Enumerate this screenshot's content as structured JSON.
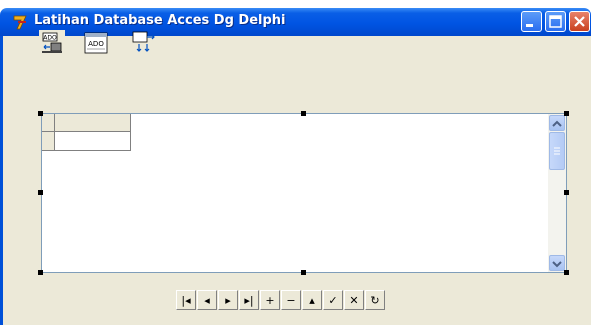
{
  "window": {
    "title": "Latihan Database Acces Dg Delphi"
  },
  "colors": {
    "titlebar": "#0054e3",
    "client": "#ece9d8",
    "close": "#c9401e"
  },
  "components": [
    {
      "name": "adoconnection-icon",
      "label": "ADO"
    },
    {
      "name": "adotable-icon",
      "label": "ADO"
    },
    {
      "name": "datasource-icon",
      "label": ""
    }
  ],
  "navigator": {
    "buttons": [
      {
        "name": "nav-first-button",
        "glyph": "|◂"
      },
      {
        "name": "nav-prior-button",
        "glyph": "◂"
      },
      {
        "name": "nav-next-button",
        "glyph": "▸"
      },
      {
        "name": "nav-last-button",
        "glyph": "▸|"
      },
      {
        "name": "nav-insert-button",
        "glyph": "+"
      },
      {
        "name": "nav-delete-button",
        "glyph": "−"
      },
      {
        "name": "nav-edit-button",
        "glyph": "▴"
      },
      {
        "name": "nav-post-button",
        "glyph": "✓"
      },
      {
        "name": "nav-cancel-button",
        "glyph": "✕"
      },
      {
        "name": "nav-refresh-button",
        "glyph": "↻"
      }
    ]
  }
}
